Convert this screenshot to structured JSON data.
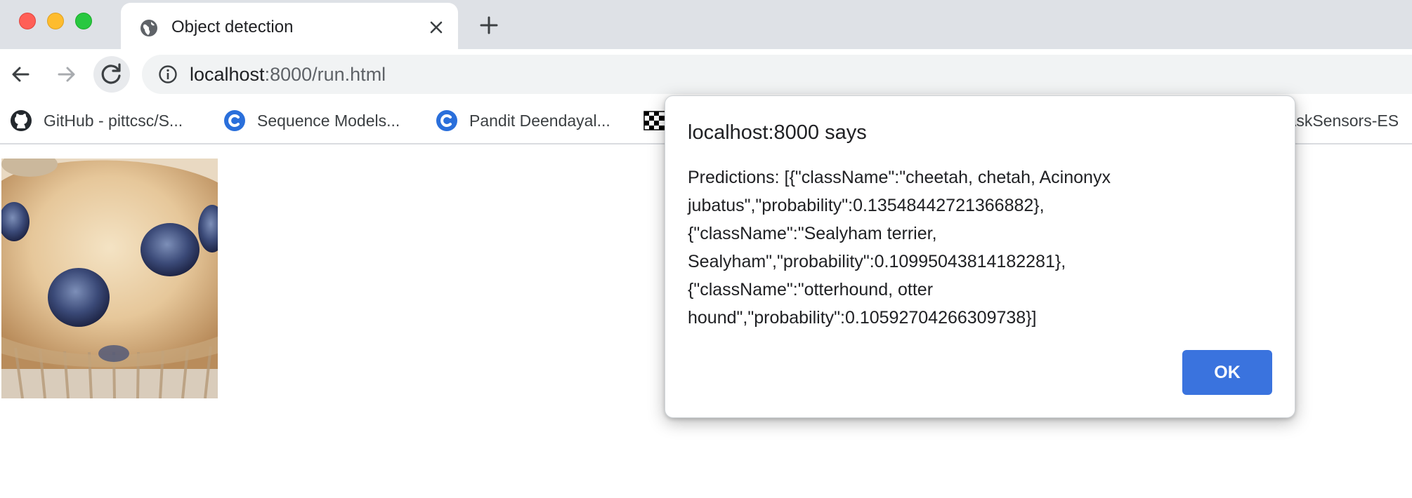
{
  "window": {
    "tab_title": "Object detection"
  },
  "toolbar": {
    "url_host": "localhost",
    "url_rest": ":8000/run.html"
  },
  "bookmarks": [
    {
      "label": "GitHub - pittcsc/S...",
      "icon": "github-icon"
    },
    {
      "label": "Sequence Models...",
      "icon": "coursera-icon"
    },
    {
      "label": "Pandit Deendayal...",
      "icon": "coursera-icon"
    },
    {
      "label": "",
      "icon": "grid-icon"
    },
    {
      "label": "AskSensors-ES",
      "icon": "none"
    }
  ],
  "page": {
    "image": "muffin-photo"
  },
  "dialog": {
    "title": "localhost:8000 says",
    "message_lines": [
      "Predictions: [{\"className\":\"cheetah, chetah, Acinonyx",
      "jubatus\",\"probability\":0.13548442721366882},",
      "{\"className\":\"Sealyham terrier,",
      "Sealyham\",\"probability\":0.10995043814182281},",
      "{\"className\":\"otterhound, otter",
      "hound\",\"probability\":0.10592704266309738}]"
    ],
    "ok_label": "OK"
  },
  "colors": {
    "tabstrip": "#dee1e6",
    "accent": "#3a73de",
    "traffic_red": "#ff5f57",
    "traffic_yellow": "#febc2e",
    "traffic_green": "#28c840"
  }
}
